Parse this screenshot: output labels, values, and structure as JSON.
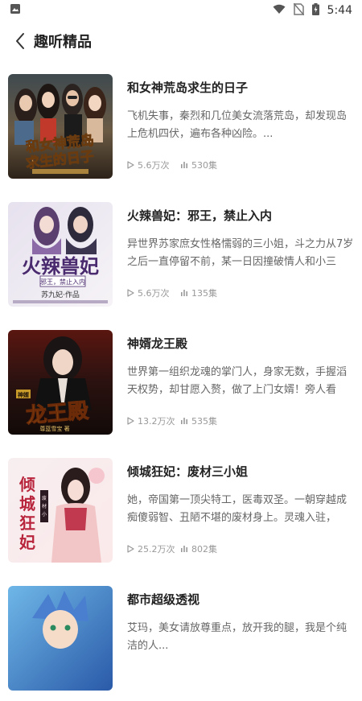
{
  "status_bar": {
    "time": "5:44"
  },
  "header": {
    "title": "趣听精品"
  },
  "items": [
    {
      "title": "和女神荒岛求生的日子",
      "desc": "飞机失事，秦烈和几位美女流落荒岛，却发现岛上危机四伏，遍布各种凶险。...",
      "plays": "5.6万次",
      "episodes": "530集",
      "cover_text": "和女神荒岛求生的日子"
    },
    {
      "title": "火辣兽妃：邪王，禁止入内",
      "desc": "异世界苏家庶女性格懦弱的三小姐，斗之力从7岁之后一直停留不前，某一日因撞破情人和小三的...",
      "plays": "5.6万次",
      "episodes": "135集",
      "cover_text": "火辣兽妃",
      "cover_sub": "邪王，禁止入内",
      "cover_author": "苏九妃 作品"
    },
    {
      "title": "神婿龙王殿",
      "desc": "世界第一组织龙魂的掌门人，身家无数，手握滔天权势，却甘愿入赘，做了上门女婿！旁人看他...",
      "plays": "13.2万次",
      "episodes": "535集",
      "cover_text": "龙王殿",
      "cover_badge": "神婿"
    },
    {
      "title": "倾城狂妃：废材三小姐",
      "desc": "她，帝国第一顶尖特工，医毒双圣。一朝穿越成痴傻弱智、丑陋不堪的废材身上。灵魂入驻，凤...",
      "plays": "25.2万次",
      "episodes": "802集",
      "cover_text": "倾城狂妃"
    },
    {
      "title": "都市超级透视",
      "desc": "艾玛，美女请放尊重点，放开我的腿，我是个纯洁的人...",
      "plays": "",
      "episodes": "",
      "cover_text": ""
    }
  ],
  "colors": {
    "accent": "#222222",
    "muted": "#999999"
  }
}
